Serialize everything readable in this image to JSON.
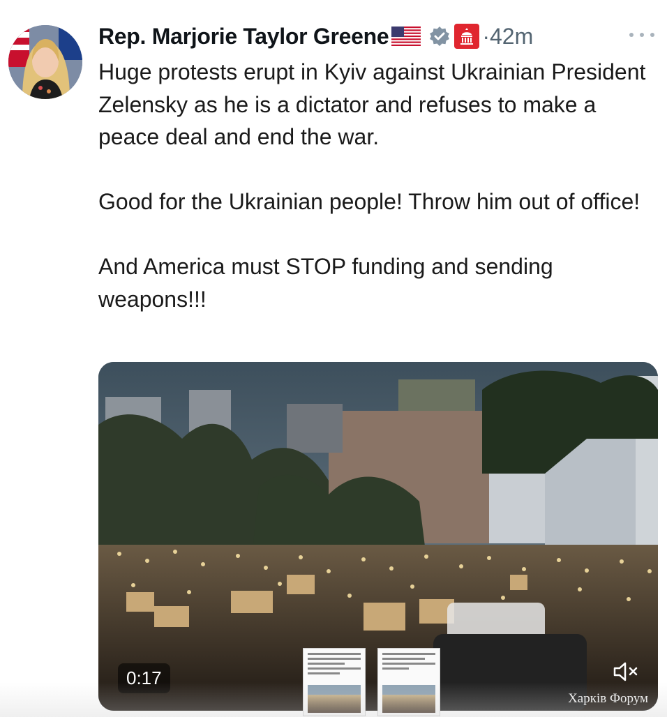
{
  "tweet": {
    "author_name": "Rep. Marjorie Taylor Greene",
    "timestamp": "·42m",
    "paragraphs": [
      "Huge protests erupt in Kyiv against Ukrainian President Zelensky as he is a dictator and refuses to make a peace deal and end the war.",
      "Good for the Ukrainian people! Throw him out of office!",
      "And America must STOP funding and sending weapons!!!"
    ],
    "badges": [
      "us-flag-icon",
      "verified-icon",
      "government-capitol-icon"
    ],
    "more_icon": "more-icon"
  },
  "media": {
    "duration": "0:17",
    "mute_icon": "speaker-muted-icon",
    "watermark": "Харків Форум"
  },
  "colors": {
    "text": "#0f1419",
    "secondary": "#536471",
    "verified_badge": "#8293a3",
    "gov_badge": "#e0262f"
  }
}
